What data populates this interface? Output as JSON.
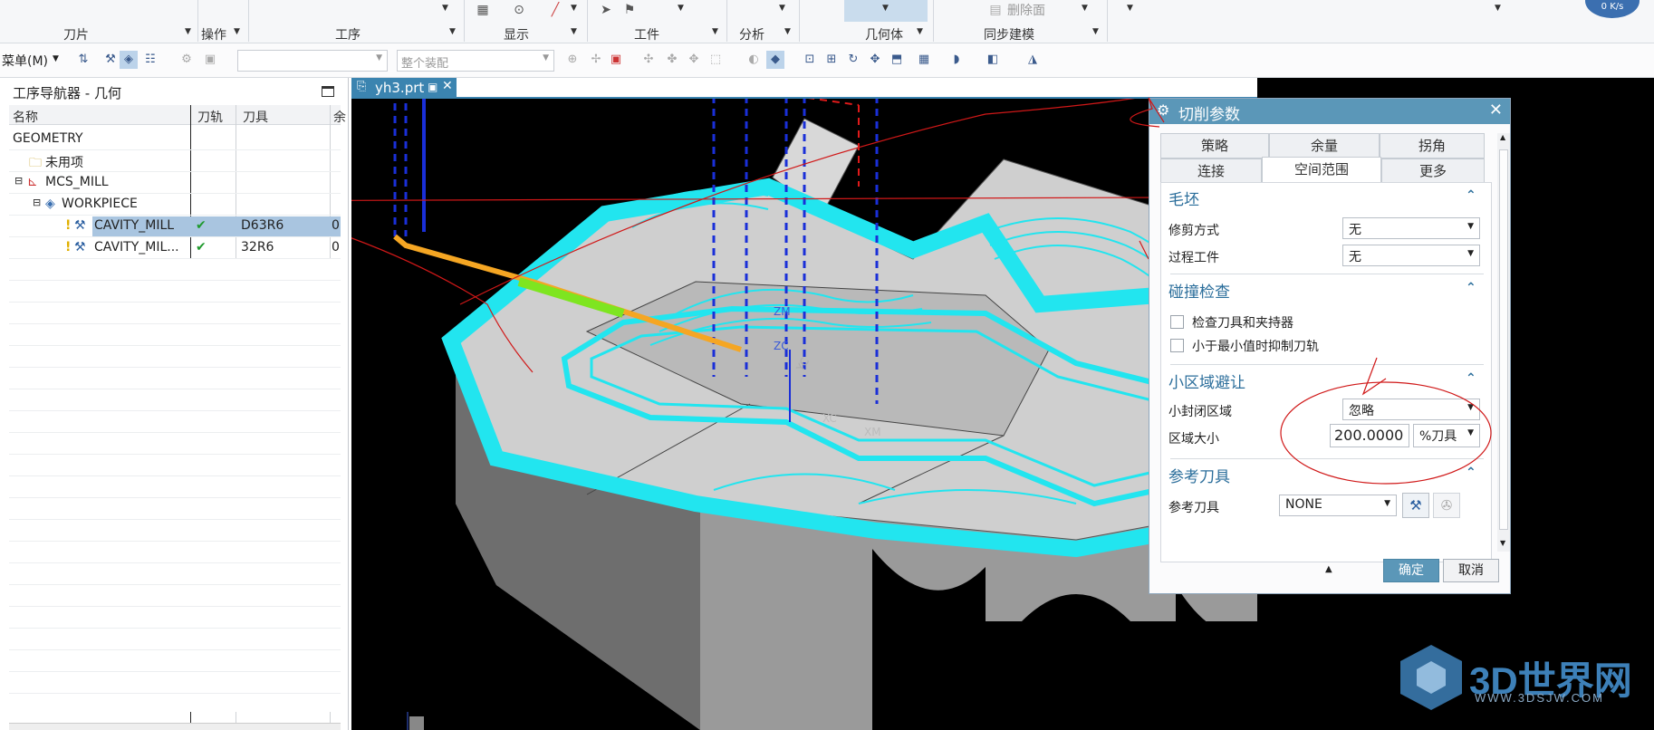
{
  "ribbon": {
    "groups": [
      "刀片",
      "操作",
      "工序",
      "显示",
      "工件",
      "分析",
      "几何体",
      "同步建模"
    ],
    "delete_face": "删除面",
    "speed": "0 K/s"
  },
  "toolbar": {
    "menu_label": "菜单(M)",
    "assembly_placeholder": "整个装配"
  },
  "navigator": {
    "title": "工序导航器 - 几何",
    "columns": [
      "名称",
      "刀轨",
      "刀具",
      "余"
    ],
    "rows": [
      {
        "name": "GEOMETRY",
        "path": "",
        "tool": "",
        "extra": ""
      },
      {
        "name": "未用项",
        "path": "",
        "tool": "",
        "extra": ""
      },
      {
        "name": "MCS_MILL",
        "path": "",
        "tool": "",
        "extra": ""
      },
      {
        "name": "WORKPIECE",
        "path": "",
        "tool": "",
        "extra": ""
      },
      {
        "name": "CAVITY_MILL",
        "path": "✔",
        "tool": "D63R6",
        "extra": "0"
      },
      {
        "name": "CAVITY_MIL...",
        "path": "✔",
        "tool": "32R6",
        "extra": "0"
      }
    ]
  },
  "document_tab": {
    "label": "yh3.prt"
  },
  "viewport": {
    "axis_labels": [
      "ZM",
      "ZC",
      "YC",
      "XC",
      "XM"
    ]
  },
  "dialog": {
    "title": "切削参数",
    "tabs_row1": [
      "策略",
      "余量",
      "拐角"
    ],
    "tabs_row2": [
      "连接",
      "空间范围",
      "更多"
    ],
    "active_tab": "空间范围",
    "blank": {
      "title": "毛坯",
      "trim_label": "修剪方式",
      "trim_value": "无",
      "ipw_label": "过程工件",
      "ipw_value": "无"
    },
    "collision": {
      "title": "碰撞检查",
      "check_holder": "检查刀具和夹持器",
      "suppress": "小于最小值时抑制刀轨"
    },
    "small_area": {
      "title": "小区域避让",
      "closed_label": "小封闭区域",
      "closed_value": "忽略",
      "size_label": "区域大小",
      "size_value": "200.0000",
      "size_unit": "%刀具"
    },
    "ref_tool": {
      "title": "参考刀具",
      "label": "参考刀具",
      "value": "NONE"
    },
    "ok": "确定",
    "cancel": "取消"
  },
  "watermark": {
    "text": "3D世界网",
    "url": "WWW.3DSJW.COM"
  },
  "colors": {
    "accent": "#5b97b8",
    "toolpath": "#22e5ef",
    "annotation": "#d01818"
  }
}
